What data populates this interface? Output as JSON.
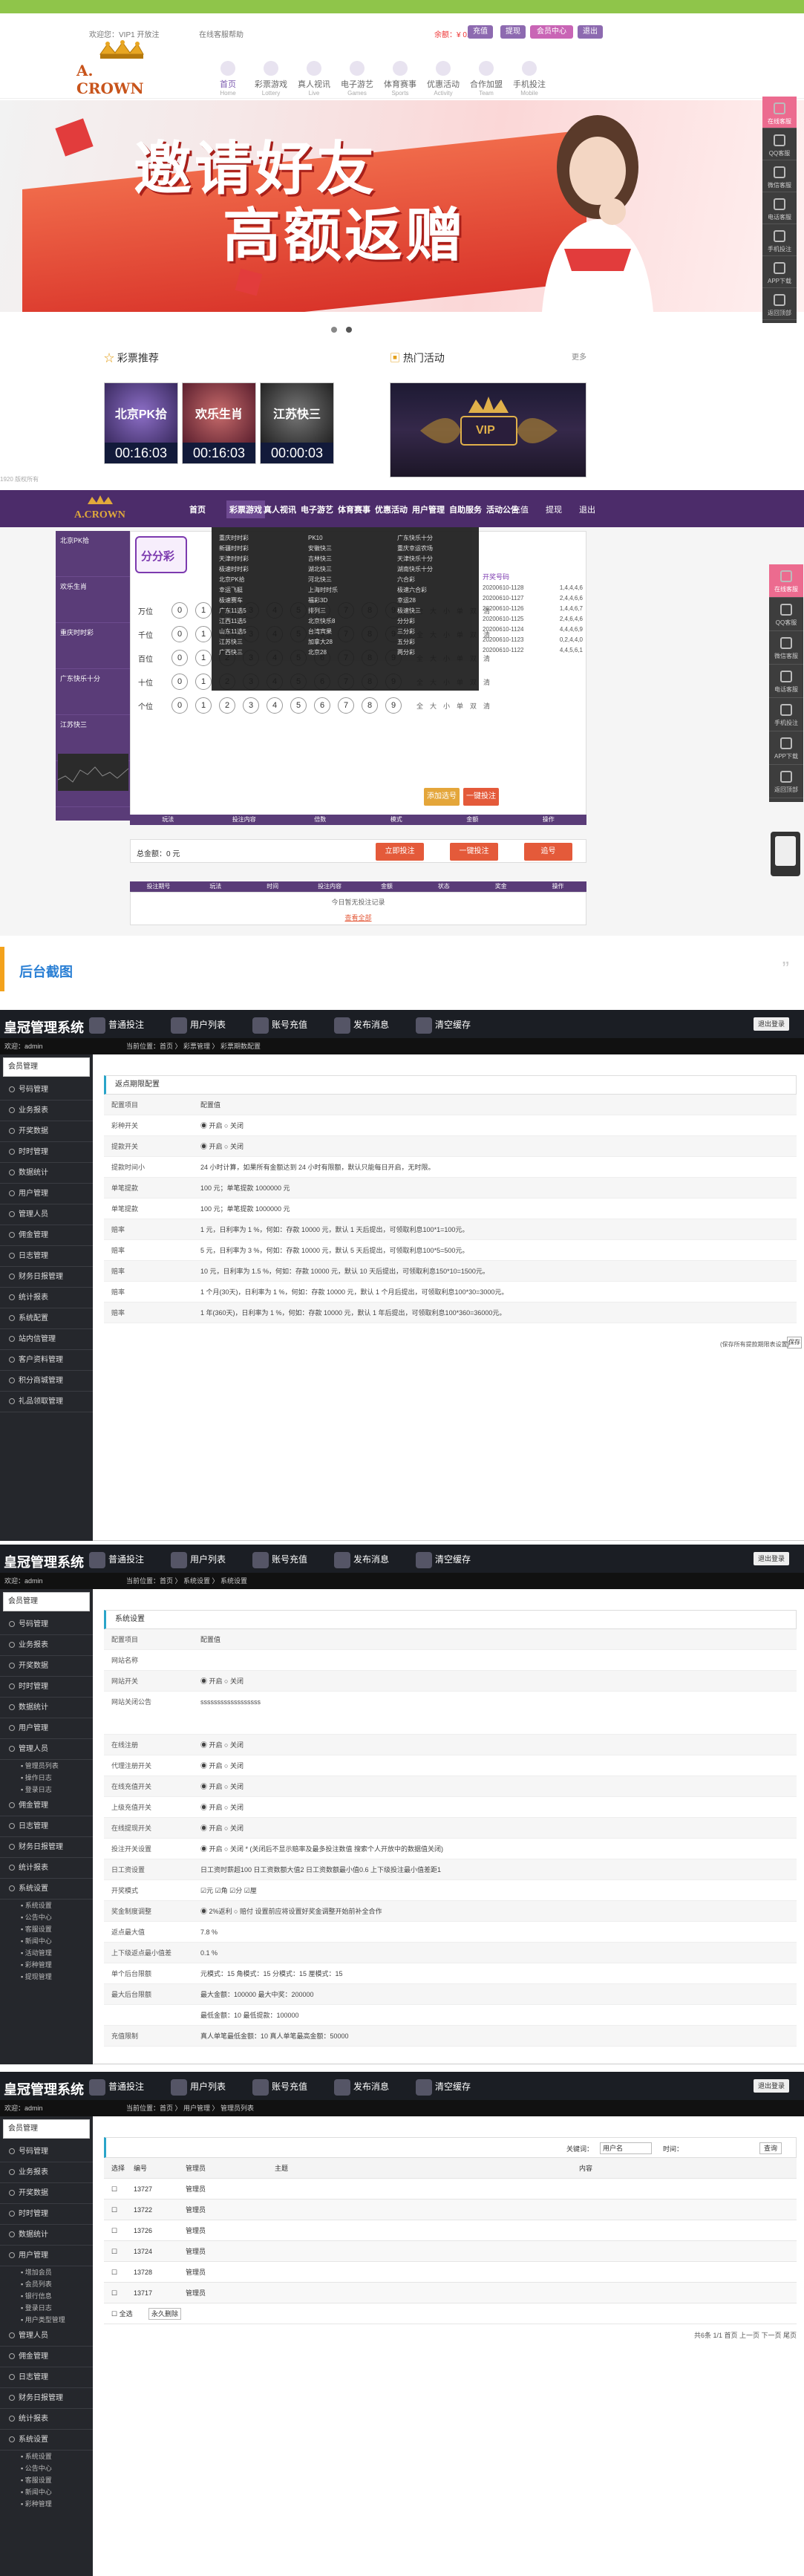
{
  "site": {
    "welcome": "欢迎您：VIP1 开放注",
    "help": "在线客服帮助",
    "balance_label": "余额：¥ 0.000",
    "btn_deposit": "充值",
    "btn_withdraw": "提现",
    "btn_member": "会员中心",
    "btn_logout": "退出",
    "logo_text": "A. CROWN",
    "nav": [
      {
        "cn": "首页",
        "en": "Home"
      },
      {
        "cn": "彩票游戏",
        "en": "Lottery"
      },
      {
        "cn": "真人视讯",
        "en": "Live"
      },
      {
        "cn": "电子游艺",
        "en": "Games"
      },
      {
        "cn": "体育赛事",
        "en": "Sports"
      },
      {
        "cn": "优惠活动",
        "en": "Activity"
      },
      {
        "cn": "合作加盟",
        "en": "Team"
      },
      {
        "cn": "手机投注",
        "en": "Mobile"
      }
    ],
    "banner_line1": "邀请好友",
    "banner_line2": "高额返赠",
    "side_rail": [
      "在线客服",
      "QQ客服",
      "微信客服",
      "电话客服",
      "手机投注",
      "APP下载",
      "返回顶部"
    ],
    "recommend_title": "彩票推荐",
    "hot_title": "热门活动",
    "more": "更多",
    "games": [
      {
        "name": "北京PK拾",
        "time": "00:16:03"
      },
      {
        "name": "欢乐生肖",
        "time": "00:16:03"
      },
      {
        "name": "江苏快三",
        "time": "00:00:03"
      }
    ],
    "hot_caption": "VIP",
    "watermark": "1920 版权所有"
  },
  "lottery": {
    "nav": [
      "首页",
      "彩票游戏",
      "真人视讯",
      "电子游艺",
      "体育赛事",
      "优惠活动",
      "用户管理",
      "自助服务",
      "活动公告"
    ],
    "nav_right": [
      "充值",
      "提现",
      "退出"
    ],
    "dropdown": [
      [
        "重庆时时彩",
        "新疆时时彩",
        "天津时时彩",
        "极速时时彩",
        "北京PK拾",
        "幸运飞艇",
        "极速赛车",
        "广东11选5",
        "江西11选5",
        "山东11选5",
        "江苏快三",
        "广西快三"
      ],
      [
        "PK10",
        "安徽快三",
        "吉林快三",
        "湖北快三",
        "河北快三",
        "上海时时乐",
        "福彩3D",
        "排列三",
        "北京快乐8",
        "台湾宾果",
        "加拿大28",
        "北京28"
      ],
      [
        "广东快乐十分",
        "重庆幸运农场",
        "天津快乐十分",
        "湖南快乐十分",
        "六合彩",
        "极速六合彩",
        "幸运28",
        "极速快三",
        "分分彩",
        "三分彩",
        "五分彩",
        "两分彩"
      ]
    ],
    "card_items": [
      "北京PK拾",
      "欢乐生肖",
      "重庆时时彩",
      "广东快乐十分",
      "江苏快三",
      "热门彩票"
    ],
    "game_title": "分分彩",
    "rows": [
      "万位",
      "千位",
      "百位",
      "十位",
      "个位"
    ],
    "balls": [
      "0",
      "1",
      "2",
      "3",
      "4",
      "5",
      "6",
      "7",
      "8",
      "9"
    ],
    "quick": [
      "全",
      "大",
      "小",
      "单",
      "双",
      "清"
    ],
    "btn_add": "添加选号",
    "btn_quick": "一键投注",
    "btn_confirm": "立即投注",
    "btn_chase": "追号",
    "history_title": "开奖号码",
    "history": [
      {
        "issue": "20200610-1128",
        "num": "1,4,4,4,6"
      },
      {
        "issue": "20200610-1127",
        "num": "2,4,4,6,6"
      },
      {
        "issue": "20200610-1126",
        "num": "1,4,4,6,7"
      },
      {
        "issue": "20200610-1125",
        "num": "2,4,6,4,6"
      },
      {
        "issue": "20200610-1124",
        "num": "4,4,4,6,9"
      },
      {
        "issue": "20200610-1123",
        "num": "0,2,4,4,0"
      },
      {
        "issue": "20200610-1122",
        "num": "4,4,5,6,1"
      }
    ],
    "summary": "总金额：0 元",
    "record_headers": [
      "玩法",
      "投注内容",
      "倍数",
      "模式",
      "金额",
      "操作"
    ],
    "bottom_headers": [
      "投注期号",
      "玩法",
      "时间",
      "投注内容",
      "金额",
      "状态",
      "奖金",
      "操作"
    ],
    "empty": "今日暂无投注记录",
    "view_all": "查看全部"
  },
  "section_title": "后台截图",
  "admin": {
    "brand": "皇冠管理系统",
    "toolbar": [
      "普通投注",
      "用户列表",
      "账号充值",
      "发布消息",
      "清空缓存"
    ],
    "logout": "退出登录",
    "user": "欢迎：admin",
    "crumb1": "当前位置：首页 〉 彩票管理 〉 彩票期数配置",
    "crumb2": "当前位置：首页 〉 系统设置 〉 系统设置",
    "crumb3": "当前位置：首页 〉 用户管理 〉 管理员列表",
    "side_head": "会员管理",
    "menu1": [
      "号码管理",
      "业务报表",
      "开奖数据",
      "时时管理",
      "数据统计",
      "用户管理",
      "管理人员",
      "佣金管理",
      "日志管理",
      "财务日报管理",
      "统计报表",
      "系统配置",
      "站内信管理",
      "客户资料管理",
      "积分商城管理",
      "礼品领取管理"
    ],
    "menu2": [
      "号码管理",
      "业务报表",
      "开奖数据",
      "时时管理",
      "数据统计",
      "用户管理",
      "管理人员"
    ],
    "menu2_sub": [
      "管理员列表",
      "操作日志",
      "登录日志"
    ],
    "menu2_after": [
      "佣金管理",
      "日志管理",
      "财务日报管理",
      "统计报表",
      "系统设置"
    ],
    "menu2_sub2": [
      "系统设置",
      "公告中心",
      "客服设置",
      "新闻中心",
      "活动管理",
      "彩种管理",
      "提现管理"
    ],
    "menu3": [
      "号码管理",
      "业务报表",
      "开奖数据",
      "时时管理",
      "数据统计",
      "用户管理"
    ],
    "menu3_sub": [
      "增加会员",
      "会员列表",
      "银行信息",
      "登录日志",
      "用户类型管理"
    ],
    "menu3_after": [
      "管理人员",
      "佣金管理",
      "日志管理",
      "财务日报管理",
      "统计报表",
      "系统设置"
    ],
    "menu3_sub2": [
      "系统设置",
      "公告中心",
      "客服设置",
      "新闻中心",
      "彩种管理"
    ],
    "form1_title": "返点期限配置",
    "form1": [
      {
        "l": "彩种开关",
        "v": "◉ 开启  ○ 关闭"
      },
      {
        "l": "提款开关",
        "v": "◉ 开启  ○ 关闭"
      },
      {
        "l": "提款时间小",
        "v": "24   小时计算，如果所有金额达到 24 小时有限额，默认只能每日开启，无时限。"
      },
      {
        "l": "单笔提款",
        "v": "100   元；单笔提款 1000000  元"
      },
      {
        "l": "单笔提款",
        "v": "100   元；单笔提款 1000000  元"
      },
      {
        "l": "赔率",
        "v": "1   元，日利率为 1   %，何如：存款 10000   元，默认 1 天后提出，可领取利息100*1=100元。"
      },
      {
        "l": "赔率",
        "v": "5   元，日利率为 3   %，何如：存款 10000   元，默认 5 天后提出，可领取利息100*5=500元。"
      },
      {
        "l": "赔率",
        "v": "10   元，日利率为 1.5   %，何如：存款 10000   元，默认 10 天后提出，可领取利息150*10=1500元。"
      },
      {
        "l": "赔率",
        "v": "1   个月(30天)，日利率为 1   %，何如：存款 10000   元，默认 1 个月后提出，可领取利息100*30=3000元。"
      },
      {
        "l": "赔率",
        "v": "1   年(360天)，日利率为 1   %，何如：存款 10000   元，默认 1 年后提出，可领取利息100*360=36000元。"
      }
    ],
    "form1_save": "保存",
    "form1_note": "(保存所有提款期限表设置)",
    "form2_title": "系统设置",
    "form2": [
      {
        "l": "网站名称",
        "v": ""
      },
      {
        "l": "网站开关",
        "v": "◉ 开启  ○ 关闭"
      },
      {
        "l": "网站关闭公告",
        "v": "ssssssssssssssssss"
      },
      {
        "l": "在线注册",
        "v": "◉ 开启  ○ 关闭"
      },
      {
        "l": "代理注册开关",
        "v": "◉ 开启  ○ 关闭"
      },
      {
        "l": "在线充值开关",
        "v": "◉ 开启  ○ 关闭"
      },
      {
        "l": "上级充值开关",
        "v": "◉ 开启  ○ 关闭"
      },
      {
        "l": "在线提现开关",
        "v": "◉ 开启  ○ 关闭"
      },
      {
        "l": "投注开关设置",
        "v": "◉ 开启  ○ 关闭  * (关闭后不显示赔率及最多投注数值 搜索个人开放中的数据值关闭)"
      },
      {
        "l": "日工资设置",
        "v": "日工资时薪超100   日工资数额大值2   日工资数额最小值0.6   上下级投注最小值差距1"
      },
      {
        "l": "开奖模式",
        "v": "☑元  ☑角  ☑分  ☑厘"
      },
      {
        "l": "奖金制度调整",
        "v": "◉ 2%返利  ○ 赔付    设置前应将设置好奖金调整开始前补全合作"
      },
      {
        "l": "返点最大值",
        "v": "7.8   %"
      },
      {
        "l": "上下级返点最小值差",
        "v": "0.1   %"
      },
      {
        "l": "单个后台限额",
        "v": "元模式：15   角模式：15   分模式：15   厘模式：15"
      },
      {
        "l": "最大后台限额",
        "v": "最大金额：100000   最大中奖：200000"
      },
      {
        "l": "",
        "v": "最低金额：10   最低提款：100000"
      },
      {
        "l": "充值限制",
        "v": "真人单笔最低金额：10   真人单笔最高金额：50000"
      }
    ],
    "search_label": "关键词：",
    "search_type": "用户名",
    "search_time": "时间：",
    "search_btn": "查询",
    "table_headers": [
      "选择",
      "编号",
      "管理员",
      "主题",
      "内容"
    ],
    "table_rows": [
      {
        "id": "13727",
        "name": "管理员"
      },
      {
        "id": "13722",
        "name": "管理员"
      },
      {
        "id": "13726",
        "name": "管理员"
      },
      {
        "id": "13724",
        "name": "管理员"
      },
      {
        "id": "13728",
        "name": "管理员"
      },
      {
        "id": "13717",
        "name": "管理员"
      }
    ],
    "select_all": "全选",
    "btn_delete": "永久删除",
    "pagination": "共6条 1/1 首页 上一页 下一页 尾页"
  }
}
